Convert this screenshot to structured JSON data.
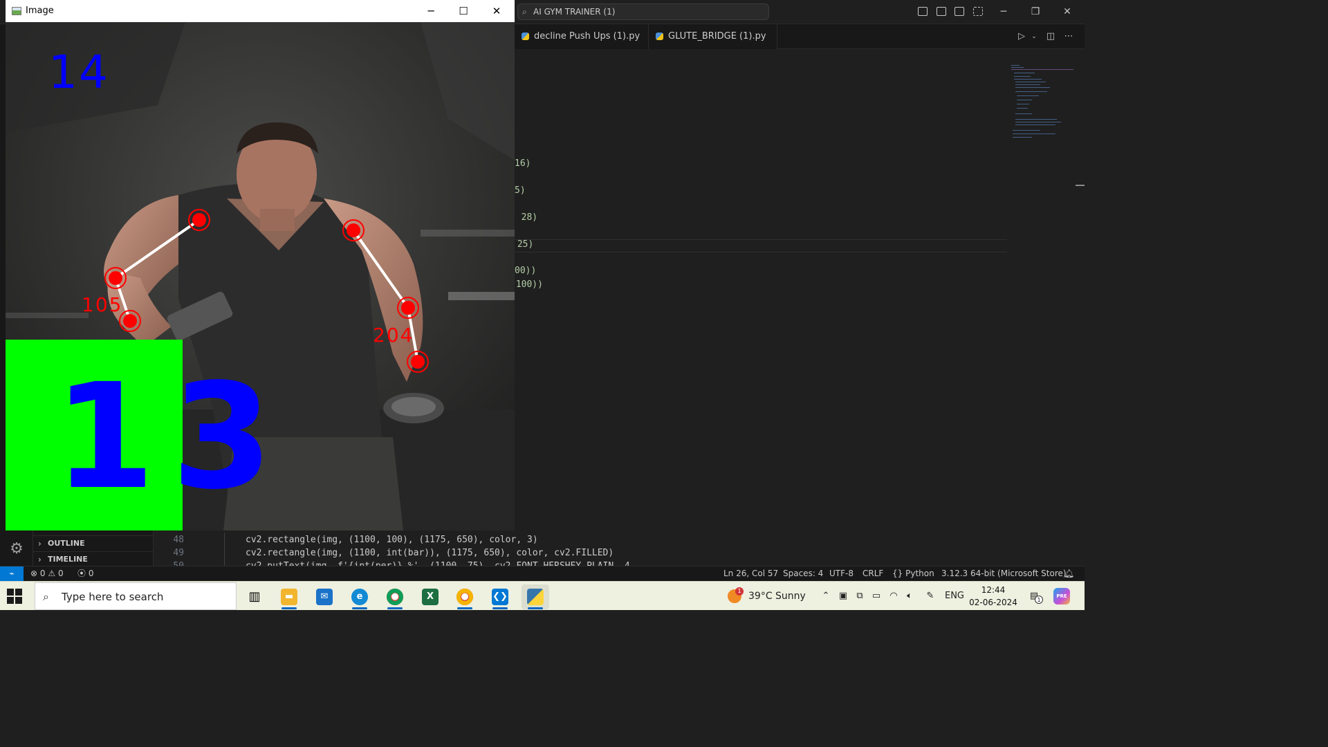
{
  "titlebar": {
    "search_text": "AI GYM TRAINER (1)"
  },
  "tabs": [
    {
      "label": "decline Push Ups (1).py"
    },
    {
      "label": "GLUTE_BRIDGE (1).py"
    }
  ],
  "editor_fragments": [
    {
      "text": "16)",
      "color": "#b5cea8"
    },
    {
      "text": "5)",
      "color": "#b5cea8"
    },
    {
      "text": ", 28)",
      "color": "#b5cea8"
    },
    {
      "text": " 25)",
      "color": "#b5cea8"
    },
    {
      "text": "00))",
      "color": "#b5cea8"
    },
    {
      "text": " 100))",
      "color": "#b5cea8"
    }
  ],
  "sidebar": {
    "sections": [
      {
        "label": "OUTLINE"
      },
      {
        "label": "TIMELINE"
      }
    ]
  },
  "code": {
    "lines": [
      {
        "number": "48",
        "text": "cv2.rectangle(img, (1100, 100), (1175, 650), color, 3)"
      },
      {
        "number": "49",
        "text": "cv2.rectangle(img, (1100, int(bar)), (1175, 650), color, cv2.FILLED)"
      },
      {
        "number": "50",
        "text": "cv2.putText(img, f'{int(per)} %', (1100, 75), cv2.FONT_HERSHEY_PLAIN, 4,"
      }
    ]
  },
  "statusbar": {
    "errors": "0",
    "warnings": "0",
    "ports": "0",
    "position": "Ln 26, Col 57",
    "spaces": "Spaces: 4",
    "encoding": "UTF-8",
    "eol": "CRLF",
    "language": "Python",
    "interpreter": "3.12.3 64-bit (Microsoft Store)"
  },
  "cv_window": {
    "title": "Image",
    "top_count": "14",
    "big_count": "13",
    "angle_left": "105",
    "angle_right": "204",
    "box_color": "#00ff00",
    "count_color": "#0000ff",
    "joint_color": "#ff0000"
  },
  "taskbar": {
    "search_placeholder": "Type here to search",
    "weather": "39°C  Sunny",
    "weather_badge": "1",
    "language": "ENG",
    "time": "12:44",
    "date": "02-06-2024",
    "notification_count": "1"
  },
  "colors": {
    "accent": "#0078d4",
    "editor_bg": "#1f1f1f"
  }
}
